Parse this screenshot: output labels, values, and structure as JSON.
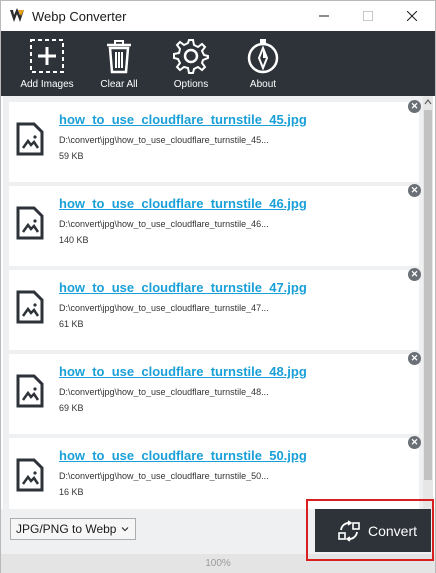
{
  "window": {
    "title": "Webp Converter"
  },
  "toolbar": {
    "items": [
      {
        "label": "Add Images",
        "icon": "add-image-icon"
      },
      {
        "label": "Clear All",
        "icon": "trash-icon"
      },
      {
        "label": "Options",
        "icon": "gear-icon"
      },
      {
        "label": "About",
        "icon": "compass-icon"
      }
    ]
  },
  "files": [
    {
      "name": "how_to_use_cloudflare_turnstile_45.jpg",
      "path": "D:\\convert\\jpg\\how_to_use_cloudflare_turnstile_45...",
      "size": "59 KB"
    },
    {
      "name": "how_to_use_cloudflare_turnstile_46.jpg",
      "path": "D:\\convert\\jpg\\how_to_use_cloudflare_turnstile_46...",
      "size": "140 KB"
    },
    {
      "name": "how_to_use_cloudflare_turnstile_47.jpg",
      "path": "D:\\convert\\jpg\\how_to_use_cloudflare_turnstile_47...",
      "size": "61 KB"
    },
    {
      "name": "how_to_use_cloudflare_turnstile_48.jpg",
      "path": "D:\\convert\\jpg\\how_to_use_cloudflare_turnstile_48...",
      "size": "69 KB"
    },
    {
      "name": "how_to_use_cloudflare_turnstile_50.jpg",
      "path": "D:\\convert\\jpg\\how_to_use_cloudflare_turnstile_50...",
      "size": "16 KB"
    }
  ],
  "bottom": {
    "format_selected": "JPG/PNG to Webp",
    "convert_label": "Convert"
  },
  "progress": {
    "value": 100,
    "label": "100%"
  },
  "colors": {
    "toolbar_bg": "#2d3339",
    "link": "#1aa0d8",
    "highlight": "#d92020"
  }
}
